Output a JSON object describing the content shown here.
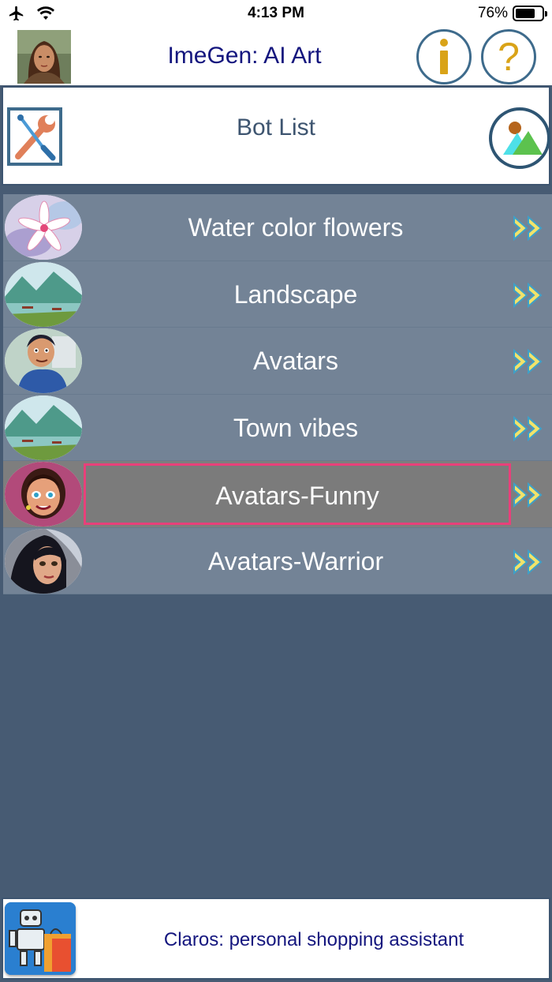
{
  "status_bar": {
    "time": "4:13 PM",
    "battery": "76%",
    "battery_level": 0.76,
    "icons": [
      "airplane-icon",
      "wifi-icon",
      "battery-icon"
    ]
  },
  "header": {
    "title": "ImeGen: AI Art",
    "info_icon": "i",
    "help_icon": "?"
  },
  "panel": {
    "title": "Bot List"
  },
  "bots": [
    {
      "name": "Water color flowers",
      "thumb": "lily-flower"
    },
    {
      "name": "Landscape",
      "thumb": "mountain-lake"
    },
    {
      "name": "Avatars",
      "thumb": "cartoon-man"
    },
    {
      "name": "Town vibes",
      "thumb": "mountain-lake"
    },
    {
      "name": "Avatars-Funny",
      "thumb": "cartoon-girl",
      "selected": true
    },
    {
      "name": "Avatars-Warrior",
      "thumb": "warrior-woman"
    }
  ],
  "footer": {
    "ad_text": "Claros: personal shopping assistant"
  },
  "colors": {
    "background": "#475B73",
    "row": "#738396",
    "selected_row": "#7E7E7E",
    "selection_border": "#E8407A",
    "title_text": "#14167E",
    "accent_gold": "#D9A318"
  }
}
